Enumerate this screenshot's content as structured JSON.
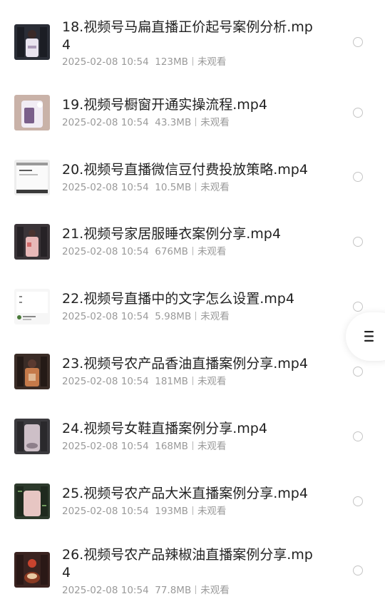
{
  "files": [
    {
      "title": "18.视频号马扁直播正价起号案例分析.mp4",
      "date": "2025-02-08 10:54",
      "size": "123MB",
      "status": "未观看",
      "thumb": "video-thumb",
      "colors": {
        "base": "#2a2d36",
        "accent": "#e9e4ef",
        "detail": "#ab9bb8"
      }
    },
    {
      "title": "19.视频号橱窗开通实操流程.mp4",
      "date": "2025-02-08 10:54",
      "size": "43.3MB",
      "status": "未观看",
      "thumb": "video-thumb",
      "colors": {
        "base": "#c9b2a8",
        "accent": "#f1ecf4",
        "detail": "#7a5f8a"
      }
    },
    {
      "title": "20.视频号直播微信豆付费投放策略.mp4",
      "date": "2025-02-08 10:54",
      "size": "10.5MB",
      "status": "未观看",
      "thumb": "video-thumb",
      "colors": {
        "base": "#ededed",
        "accent": "#fafafa",
        "detail": "#5a5a5a"
      }
    },
    {
      "title": "21.视频号家居服睡衣案例分享.mp4",
      "date": "2025-02-08 10:54",
      "size": "676MB",
      "status": "未观看",
      "thumb": "video-thumb",
      "colors": {
        "base": "#3a3438",
        "accent": "#e8b8b8",
        "detail": "#d06a6a"
      }
    },
    {
      "title": "22.视频号直播中的文字怎么设置.mp4",
      "date": "2025-02-08 10:54",
      "size": "5.98MB",
      "status": "未观看",
      "thumb": "video-thumb",
      "colors": {
        "base": "#f6f6f6",
        "accent": "#ffffff",
        "detail": "#4a7a3a"
      }
    },
    {
      "title": "23.视频号农产品香油直播案例分享.mp4",
      "date": "2025-02-08 10:54",
      "size": "181MB",
      "status": "未观看",
      "thumb": "video-thumb",
      "colors": {
        "base": "#3a2c26",
        "accent": "#c57a4a",
        "detail": "#e0b894"
      }
    },
    {
      "title": "24.视频号女鞋直播案例分享.mp4",
      "date": "2025-02-08 10:54",
      "size": "168MB",
      "status": "未观看",
      "thumb": "video-thumb",
      "colors": {
        "base": "#3b3a3e",
        "accent": "#cdbfc7",
        "detail": "#8d7f8a"
      }
    },
    {
      "title": "25.视频号农产品大米直播案例分享.mp4",
      "date": "2025-02-08 10:54",
      "size": "193MB",
      "status": "未观看",
      "thumb": "video-thumb",
      "colors": {
        "base": "#2d3a2c",
        "accent": "#e7c6c3",
        "detail": "#6f9a5e"
      }
    },
    {
      "title": "26.视频号农产品辣椒油直播案例分享.mp4",
      "date": "2025-02-08 10:54",
      "size": "77.8MB",
      "status": "未观看",
      "thumb": "video-thumb",
      "colors": {
        "base": "#3a2320",
        "accent": "#c8432e",
        "detail": "#e9c9a3"
      }
    }
  ],
  "floating_menu": {
    "icon": "menu-icon"
  }
}
